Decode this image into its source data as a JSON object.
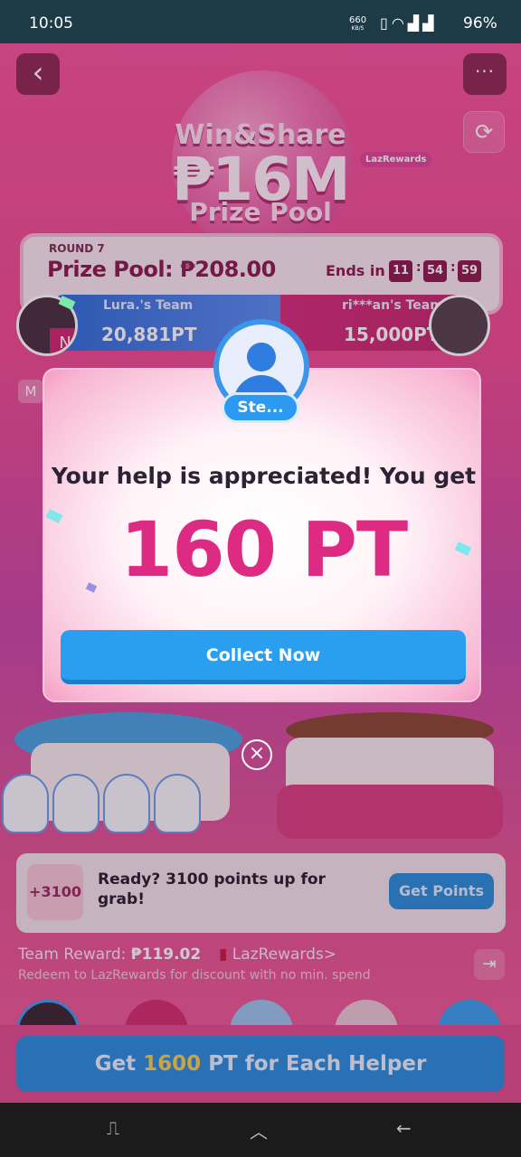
{
  "status_bar": {
    "time": "10:05",
    "net_speed": "660",
    "net_unit": "KB/S",
    "battery": "96%",
    "icons": [
      "vibrate-icon",
      "wifi-icon",
      "signal-icon",
      "signal-icon"
    ]
  },
  "header": {
    "back_glyph": "‹",
    "more_glyph": "···",
    "refresh_glyph": "⟳",
    "title_line1": "Win&Share",
    "title_line2": "₱16M",
    "title_line3": "Prize Pool",
    "brand_tag": "LazRewards"
  },
  "round": {
    "label": "ROUND 7",
    "prize_pool": "Prize Pool: ₱208.00",
    "ends_in_label": "Ends in",
    "timer": [
      "11",
      "54",
      "59"
    ]
  },
  "teams": {
    "left": {
      "name": "Lura.'s Team",
      "score": "20,881PT",
      "member_initial": "N"
    },
    "right": {
      "name": "ri***an's Team",
      "score": "15,000PT"
    },
    "side_label": "M"
  },
  "banner": {
    "badge": "+3100",
    "text": "Ready? 3100 points up for grab!",
    "button": "Get Points"
  },
  "reward": {
    "label": "Team Reward:",
    "amount": "₱119.02",
    "link": "LazRewards>",
    "redeem_note": "Redeem to LazRewards for discount with no min. spend"
  },
  "cta": {
    "prefix": "Get ",
    "points": "1600",
    "suffix": " PT for Each Helper"
  },
  "modal": {
    "helper_name": "Ste...",
    "message": "Your help is appreciated! You get",
    "points": "160 PT",
    "button": "Collect Now",
    "close_glyph": "×"
  },
  "navbar": {
    "recent_glyph": "⎍",
    "home_glyph": "︿",
    "back_glyph": "←"
  },
  "colors": {
    "accent_pink": "#dd2b83",
    "button_blue": "#2a9ff0",
    "background_pink": "#e64a8a",
    "status_bar": "#1d3b47"
  }
}
